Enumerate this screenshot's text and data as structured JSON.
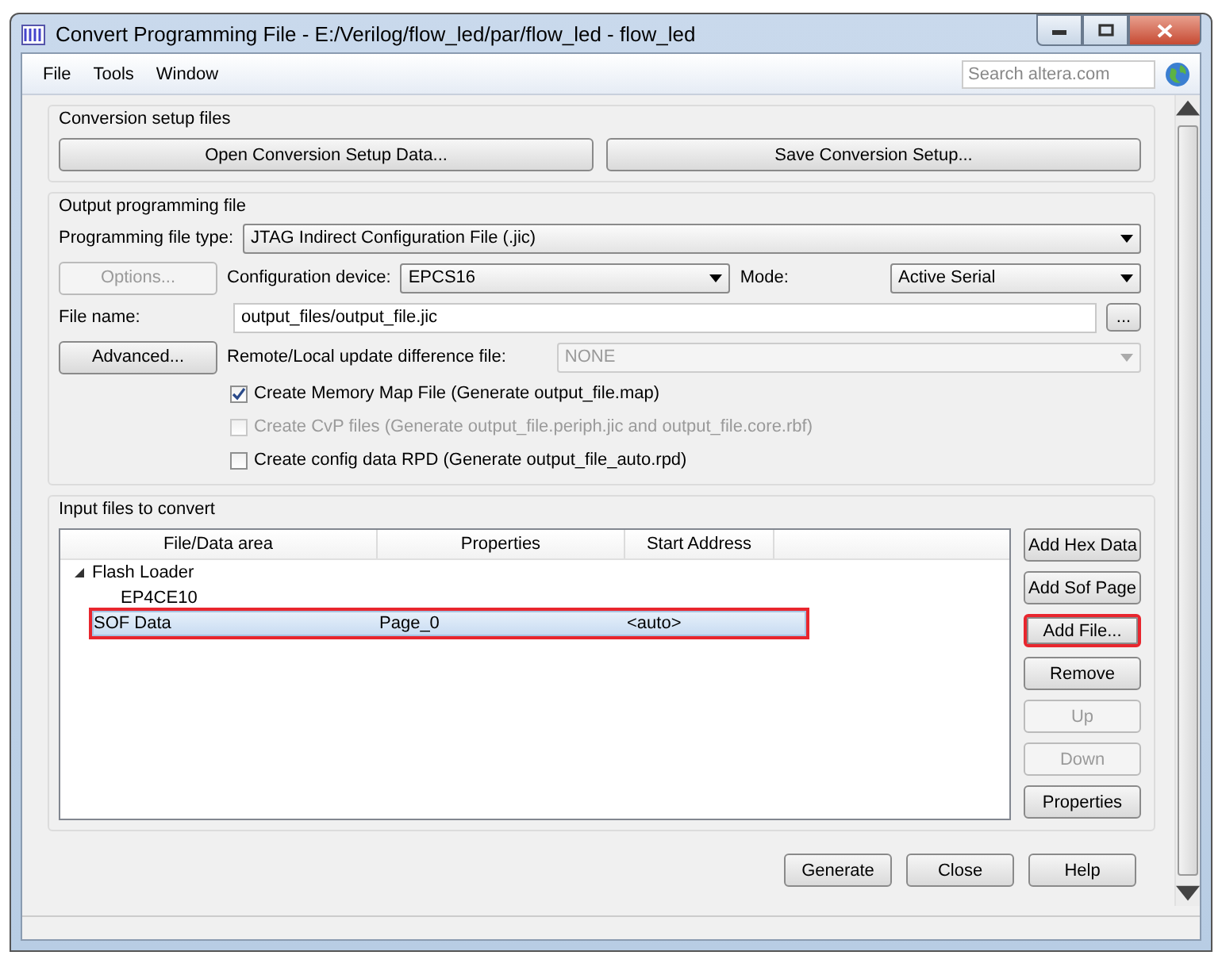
{
  "window": {
    "title": "Convert Programming File - E:/Verilog/flow_led/par/flow_led - flow_led"
  },
  "menu": [
    {
      "label": "File"
    },
    {
      "label": "Tools"
    },
    {
      "label": "Window"
    }
  ],
  "search": {
    "placeholder": "Search altera.com"
  },
  "conversion_setup": {
    "title": "Conversion setup files",
    "buttons": [
      "Open Conversion Setup Data...",
      "Save Conversion Setup..."
    ]
  },
  "output": {
    "title": "Output programming file",
    "file_type": {
      "label": "Programming file type:",
      "value": "JTAG Indirect Configuration File (.jic)"
    },
    "options_button": {
      "label": "Options...",
      "disabled": true
    },
    "device": {
      "label": "Configuration device:",
      "value": "EPCS16"
    },
    "mode": {
      "label": "Mode:",
      "value": "Active Serial"
    },
    "file_name": {
      "label": "File name:",
      "value": "output_files/output_file.jic",
      "browse": "..."
    },
    "advanced_button": {
      "label": "Advanced...",
      "disabled": false
    },
    "update_diff": {
      "label": "Remote/Local update difference file:",
      "value": "NONE",
      "disabled": true
    },
    "checkboxes": [
      {
        "label": "Create Memory Map File (Generate output_file.map)",
        "checked": true,
        "disabled": false
      },
      {
        "label": "Create CvP files (Generate output_file.periph.jic and output_file.core.rbf)",
        "checked": false,
        "disabled": true
      },
      {
        "label": "Create config data RPD (Generate output_file_auto.rpd)",
        "checked": false,
        "disabled": false
      }
    ]
  },
  "input": {
    "title": "Input files to convert",
    "columns": [
      "File/Data area",
      "Properties",
      "Start Address"
    ],
    "rows": [
      {
        "cells": [
          "Flash Loader"
        ],
        "expanded": true,
        "selected": false,
        "highlighted": false,
        "children": [
          {
            "cells": [
              "EP4CE10"
            ],
            "selected": false,
            "highlighted": false
          }
        ]
      },
      {
        "cells": [
          "SOF Data",
          "Page_0",
          "<auto>"
        ],
        "selected": true,
        "highlighted": true
      }
    ],
    "side_buttons": [
      {
        "label": "Add Hex Data",
        "disabled": false,
        "highlighted": false
      },
      {
        "label": "Add Sof Page",
        "disabled": false,
        "highlighted": false
      },
      {
        "label": "Add File...",
        "disabled": false,
        "highlighted": true
      },
      {
        "label": "Remove",
        "disabled": false,
        "highlighted": false
      },
      {
        "label": "Up",
        "disabled": true,
        "highlighted": false
      },
      {
        "label": "Down",
        "disabled": true,
        "highlighted": false
      },
      {
        "label": "Properties",
        "disabled": false,
        "highlighted": false
      }
    ]
  },
  "footer_buttons": [
    "Generate",
    "Close",
    "Help"
  ]
}
